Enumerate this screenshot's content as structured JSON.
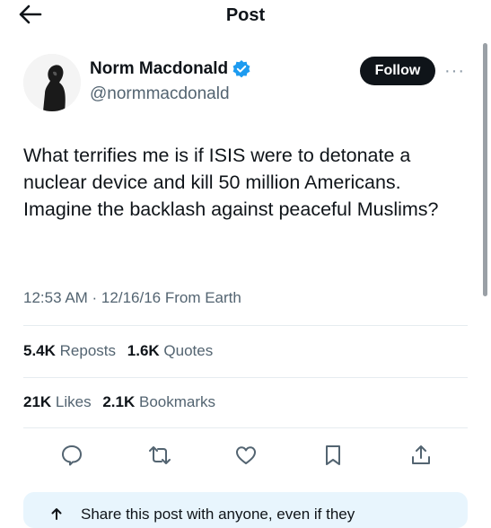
{
  "header": {
    "title": "Post"
  },
  "author": {
    "name": "Norm Macdonald",
    "handle": "@normmacdonald",
    "follow_label": "Follow",
    "more_label": "···"
  },
  "tweet": {
    "text": "What terrifies me is if ISIS were to detonate a nuclear device and kill 50 million Americans. Imagine the backlash against peaceful Muslims?",
    "meta": "12:53 AM · 12/16/16 From Earth"
  },
  "stats": {
    "reposts_count": "5.4K",
    "reposts_label": "Reposts",
    "quotes_count": "1.6K",
    "quotes_label": "Quotes",
    "likes_count": "21K",
    "likes_label": "Likes",
    "bookmarks_count": "2.1K",
    "bookmarks_label": "Bookmarks"
  },
  "share_banner": {
    "text": "Share this post with anyone, even if they"
  },
  "icons": [
    "back-arrow-icon",
    "verified-badge-icon",
    "reply-icon",
    "repost-icon",
    "like-icon",
    "bookmark-icon",
    "share-icon"
  ],
  "colors": {
    "verified": "#1d9bf0",
    "follow_bg": "#0f1419",
    "secondary_text": "#536471",
    "banner_bg": "#e8f5fd"
  }
}
